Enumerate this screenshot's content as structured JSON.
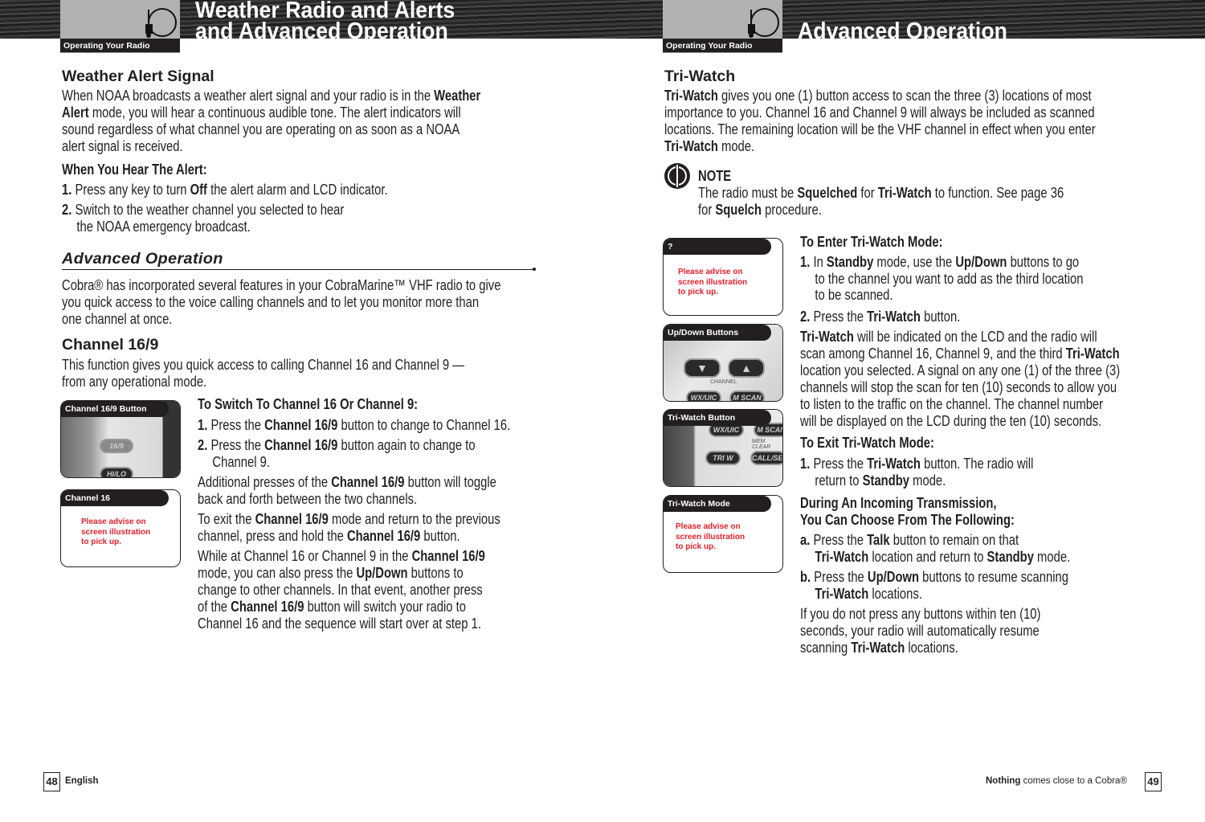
{
  "left": {
    "section_tab": "Operating Your Radio",
    "title_lines": [
      "Weather Radio and Alerts",
      "and Advanced Operation"
    ],
    "weather_heading": "Weather Alert Signal",
    "weather_body": [
      [
        "When NOAA broadcasts a weather alert signal and your radio is in the ",
        {
          "b": "Weather"
        }
      ],
      [
        {
          "b": "Alert"
        },
        " mode, you will hear a continuous audible tone. The alert indicators will"
      ],
      "sound regardless of what channel you are operating on as soon as a NOAA",
      "alert signal is received."
    ],
    "hear_heading": "When You Hear The Alert:",
    "hear_step1": [
      [
        {
          "b": "1."
        },
        " Press any key to turn ",
        {
          "b": "Off"
        },
        " the alert alarm and LCD indicator."
      ]
    ],
    "hear_step2": [
      [
        {
          "b": "2."
        },
        " Switch to the weather channel you selected to hear"
      ],
      "the NOAA emergency broadcast."
    ],
    "advanced_heading": "Advanced Operation",
    "advanced_body": [
      "Cobra® has incorporated several features in your CobraMarine™ VHF radio to give",
      "you quick access to the voice calling channels and to let you monitor more than",
      "one channel at once."
    ],
    "channel_heading": "Channel 16/9",
    "channel_body": [
      "This function gives you quick access to calling Channel 16 and Channel 9 —",
      "from any operational mode."
    ],
    "switch_heading": "To Switch To Channel 16 Or Channel 9:",
    "switch_step1": [
      [
        {
          "b": "1."
        },
        " Press the ",
        {
          "b": "Channel 16/9"
        },
        " button to change to Channel 16."
      ]
    ],
    "switch_step2": [
      [
        {
          "b": "2."
        },
        " Press the ",
        {
          "b": "Channel 16/9"
        },
        " button again to change to"
      ],
      "Channel 9."
    ],
    "additional": [
      [
        "Additional presses of the ",
        {
          "b": "Channel 16/9"
        },
        " button will toggle"
      ],
      "back and forth between the two channels."
    ],
    "exit": [
      [
        "To exit the ",
        {
          "b": "Channel 16/9"
        },
        " mode and return to the previous"
      ],
      [
        "channel, press and hold the ",
        {
          "b": "Channel 16/9"
        },
        " button."
      ]
    ],
    "while": [
      [
        "While at Channel 16 or Channel 9 in the ",
        {
          "b": "Channel 16/9"
        }
      ],
      [
        "mode, you can also press the ",
        {
          "b": "Up/Down"
        },
        " buttons to"
      ],
      "change to other channels. In that event, another press",
      [
        "of the ",
        {
          "b": "Channel 16/9"
        },
        " button will switch your radio to"
      ],
      "Channel 16 and the sequence will start over at step 1."
    ],
    "fig1": {
      "label": "Channel 16/9 Button",
      "buttons": [
        "16/9",
        "HI/LO"
      ]
    },
    "fig2": {
      "label": "Channel 16",
      "note": [
        "Please advise on",
        "screen illustration",
        "to pick up."
      ]
    },
    "page_number": "48",
    "footer": "English"
  },
  "right": {
    "section_tab": "Operating Your Radio",
    "title": "Advanced Operation",
    "tri_heading": "Tri-Watch",
    "tri_body": [
      [
        {
          "b": "Tri-Watch"
        },
        " gives you one (1) button access to scan the three (3) locations of most"
      ],
      "importance to you. Channel 16 and Channel 9 will always be included as scanned",
      "locations. The remaining location will be the VHF channel in effect when you enter",
      [
        {
          "b": "Tri-Watch"
        },
        " mode."
      ]
    ],
    "note_label": "NOTE",
    "note_body": [
      [
        "The radio must be ",
        {
          "b": "Squelched"
        },
        " for ",
        {
          "b": "Tri-Watch"
        },
        " to function. See page 36"
      ],
      [
        "for ",
        {
          "b": "Squelch"
        },
        " procedure."
      ]
    ],
    "enter_heading": "To Enter Tri-Watch Mode:",
    "enter_step1": [
      [
        {
          "b": "1."
        },
        " In ",
        {
          "b": "Standby"
        },
        " mode, use the ",
        {
          "b": "Up/Down"
        },
        " buttons to go"
      ],
      "to the channel you want to add as the third location",
      "to be scanned."
    ],
    "enter_step2": [
      [
        {
          "b": "2."
        },
        " Press the ",
        {
          "b": "Tri-Watch"
        },
        " button."
      ]
    ],
    "indicated": [
      [
        {
          "b": "Tri-Watch"
        },
        " will be indicated on the LCD and the radio will"
      ],
      [
        "scan among Channel 16, Channel 9, and the third ",
        {
          "b": "Tri-Watch"
        }
      ],
      "location you selected. A signal on any one (1) of the three (3)",
      "channels will stop the scan for ten (10) seconds to allow you",
      "to listen to the traffic on the channel. The channel number",
      "will be displayed on the LCD during the ten (10) seconds."
    ],
    "exit_heading": "To Exit Tri-Watch Mode:",
    "exit_step1": [
      [
        {
          "b": "1."
        },
        " Press the ",
        {
          "b": "Tri-Watch"
        },
        " button. The radio will"
      ],
      [
        "return to ",
        {
          "b": "Standby"
        },
        " mode."
      ]
    ],
    "during_heading": [
      [
        {
          "b": "During An Incoming Transmission,"
        }
      ],
      [
        {
          "b": "You Can Choose From The Following:"
        }
      ]
    ],
    "step_a": [
      [
        {
          "b": "a."
        },
        " Press the ",
        {
          "b": "Talk"
        },
        " button to remain on that"
      ],
      [
        {
          "b": "Tri-Watch"
        },
        " location and return to ",
        {
          "b": "Standby"
        },
        " mode."
      ]
    ],
    "step_b": [
      [
        {
          "b": "b."
        },
        " Press the ",
        {
          "b": "Up/Down"
        },
        " buttons to resume scanning"
      ],
      [
        {
          "b": "Tri-Watch"
        },
        " locations."
      ]
    ],
    "if_not": [
      "If you do not press any buttons within ten (10)",
      "seconds, your radio will automatically resume",
      [
        "scanning ",
        {
          "b": "Tri-Watch"
        },
        " locations."
      ]
    ],
    "fig1": {
      "label": "?",
      "note": [
        "Please advise on",
        "screen illustration",
        "to pick up."
      ]
    },
    "fig2": {
      "label": "Up/Down Buttons",
      "caption": "CHANNEL",
      "buttons": [
        "WX/UIC",
        "M SCAN"
      ]
    },
    "fig3": {
      "label": "Tri-Watch Button",
      "buttons": [
        "WX/UIC",
        "M SCAN",
        "TRI W",
        "CALL/SET"
      ],
      "caption": "MEM CLEAR"
    },
    "fig4": {
      "label": "Tri-Watch Mode",
      "note": [
        "Please advise on",
        "screen illustration",
        "to pick up."
      ]
    },
    "footer_bold": "Nothing",
    "footer_rest": " comes close to a Cobra®",
    "page_number": "49"
  }
}
